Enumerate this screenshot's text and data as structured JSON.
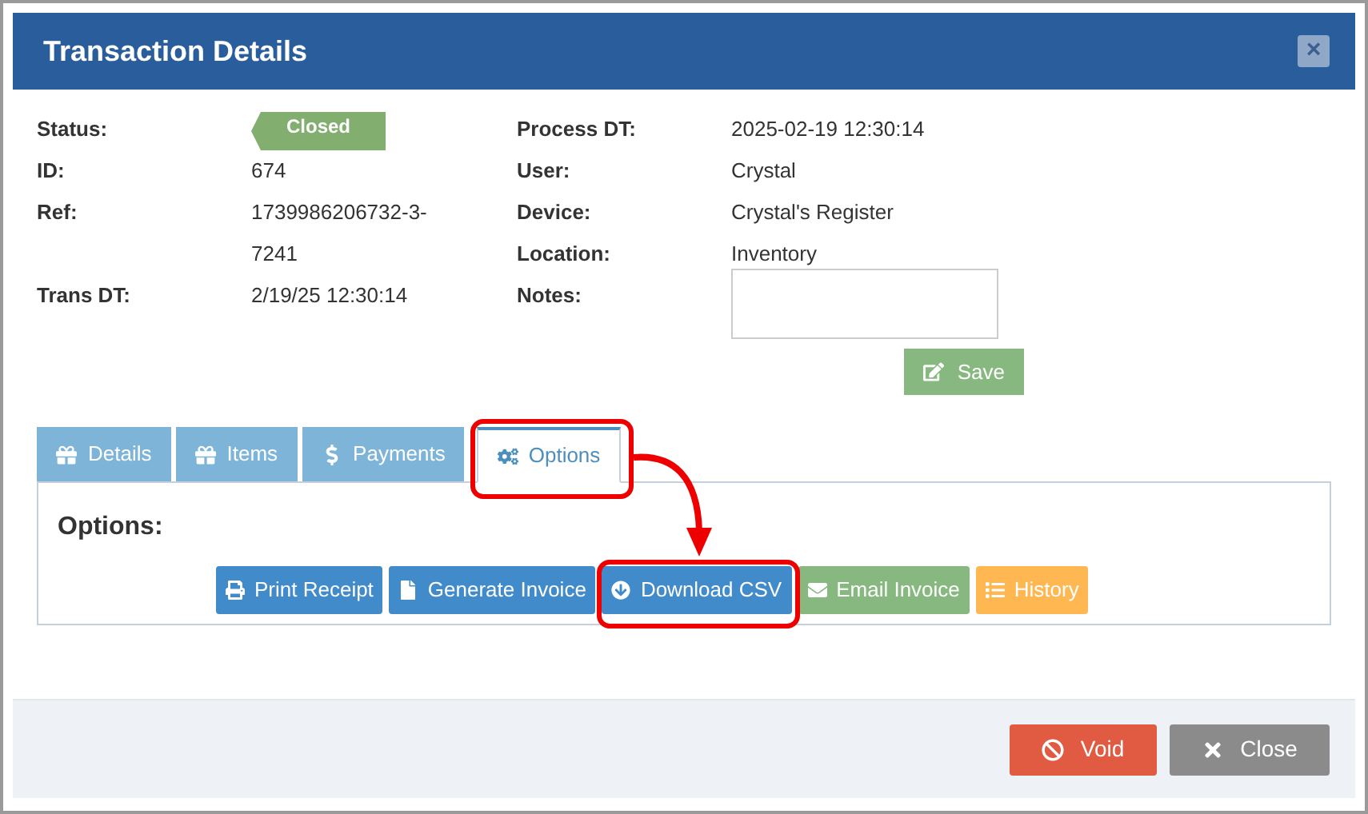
{
  "window": {
    "title": "Transaction Details",
    "close": "×"
  },
  "left_fields": [
    {
      "label": "Status:",
      "value": "Closed",
      "kind": "badge"
    },
    {
      "label": "ID:",
      "value": "674",
      "kind": "text"
    },
    {
      "label": "Ref:",
      "value": "1739986206732-3-7241",
      "kind": "text"
    },
    {
      "label": "Trans DT:",
      "value": "2/19/25 12:30:14",
      "kind": "text"
    }
  ],
  "right_fields": [
    {
      "label": "Process DT:",
      "value": "2025-02-19 12:30:14",
      "kind": "text"
    },
    {
      "label": "User:",
      "value": "Crystal",
      "kind": "text"
    },
    {
      "label": "Device:",
      "value": "Crystal's Register",
      "kind": "text"
    },
    {
      "label": "Location:",
      "value": "Inventory",
      "kind": "text"
    },
    {
      "label": "Notes:",
      "kind": "textarea"
    }
  ],
  "save_button": "Save",
  "tabs": [
    {
      "label": "Details",
      "selected": false
    },
    {
      "label": "Items",
      "selected": false
    },
    {
      "label": "Payments",
      "selected": false
    },
    {
      "label": "Options",
      "selected": true
    }
  ],
  "options": {
    "heading": "Options:",
    "buttons": [
      {
        "label": "Print Receipt",
        "color": "#428bca"
      },
      {
        "label": "Generate Invoice",
        "color": "#428bca"
      },
      {
        "label": "Download CSV",
        "color": "#428bca"
      },
      {
        "label": "Email Invoice",
        "color": "#87b87f"
      },
      {
        "label": "History",
        "color": "#ffb752"
      }
    ]
  },
  "footer": {
    "buttons": [
      {
        "label": "Void",
        "color": "#e05b42"
      },
      {
        "label": "Close",
        "color": "#8b8b8b"
      }
    ]
  }
}
